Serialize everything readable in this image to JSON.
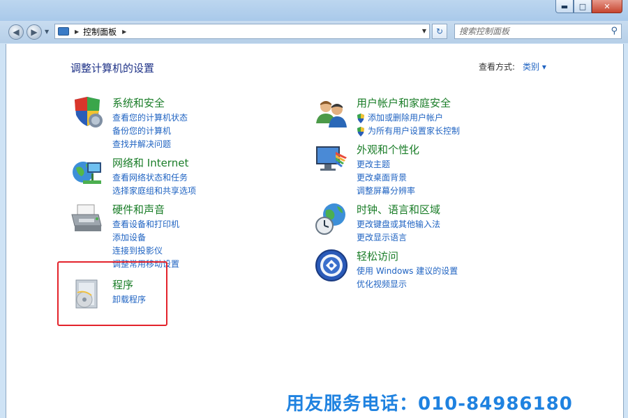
{
  "window": {
    "minimize_glyph": "▬",
    "maximize_glyph": "□",
    "close_glyph": "✕"
  },
  "nav": {
    "back_glyph": "◀",
    "forward_glyph": "▶",
    "breadcrumb": "控制面板",
    "search_placeholder": "搜索控制面板"
  },
  "header": {
    "title": "调整计算机的设置",
    "view_by_label": "查看方式:",
    "view_by_value": "类别 ▾"
  },
  "categories": {
    "system": {
      "title": "系统和安全",
      "links": [
        "查看您的计算机状态",
        "备份您的计算机",
        "查找并解决问题"
      ]
    },
    "network": {
      "title": "网络和 Internet",
      "links": [
        "查看网络状态和任务",
        "选择家庭组和共享选项"
      ]
    },
    "hardware": {
      "title": "硬件和声音",
      "links": [
        "查看设备和打印机",
        "添加设备",
        "连接到投影仪",
        "调整常用移动设置"
      ]
    },
    "programs": {
      "title": "程序",
      "links": [
        "卸载程序"
      ]
    },
    "users": {
      "title": "用户帐户和家庭安全",
      "links": [
        "添加或删除用户帐户",
        "为所有用户设置家长控制"
      ]
    },
    "appearance": {
      "title": "外观和个性化",
      "links": [
        "更改主题",
        "更改桌面背景",
        "调整屏幕分辨率"
      ]
    },
    "clock": {
      "title": "时钟、语言和区域",
      "links": [
        "更改键盘或其他输入法",
        "更改显示语言"
      ]
    },
    "ease": {
      "title": "轻松访问",
      "links": [
        "使用 Windows 建议的设置",
        "优化视频显示"
      ]
    }
  },
  "support": {
    "text": "用友服务电话：010-84986180"
  },
  "colors": {
    "category_title": "#1a7d28",
    "link": "#1f63c2",
    "highlight_box": "#e3232b",
    "support_text": "#1f82e0"
  }
}
